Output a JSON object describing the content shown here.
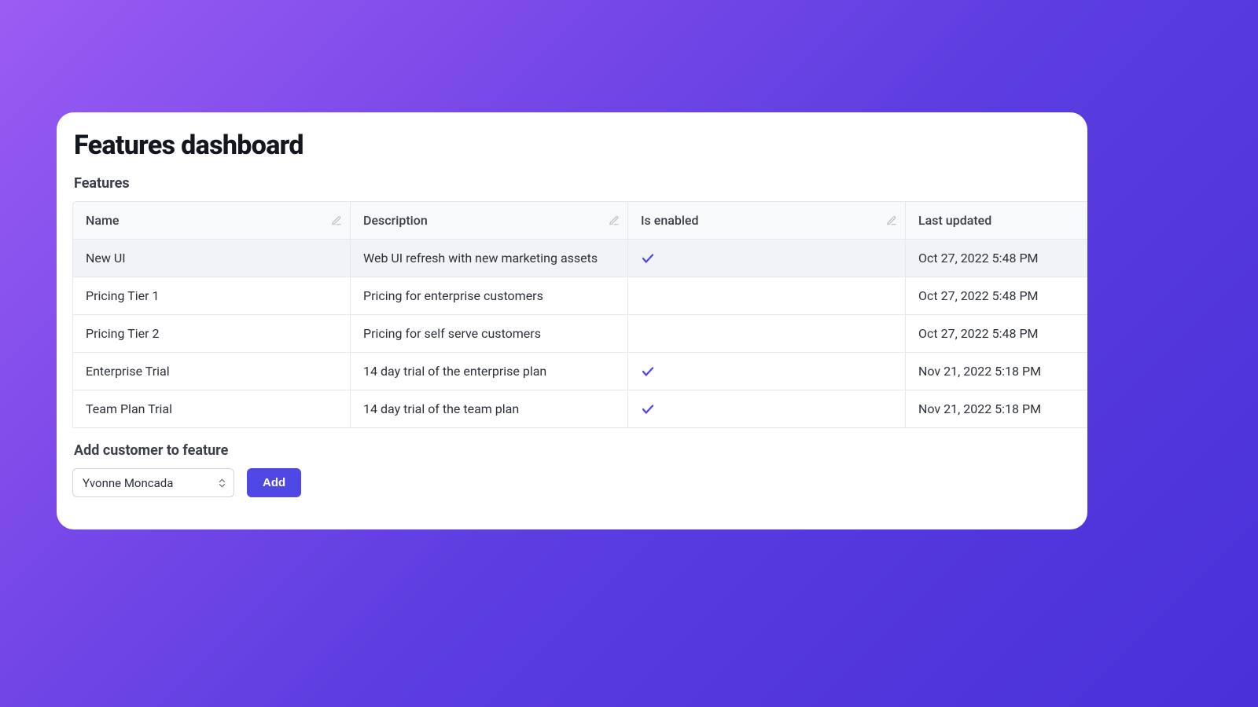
{
  "title": "Features dashboard",
  "section1_label": "Features",
  "columns": {
    "name": "Name",
    "description": "Description",
    "enabled": "Is enabled",
    "updated": "Last updated"
  },
  "rows": [
    {
      "name": "New UI",
      "description": "Web UI refresh with new marketing assets",
      "enabled": true,
      "updated": "Oct 27, 2022 5:48 PM"
    },
    {
      "name": "Pricing Tier 1",
      "description": "Pricing for enterprise customers",
      "enabled": false,
      "updated": "Oct 27, 2022 5:48 PM"
    },
    {
      "name": "Pricing Tier 2",
      "description": "Pricing for self serve customers",
      "enabled": false,
      "updated": "Oct 27, 2022 5:48 PM"
    },
    {
      "name": "Enterprise Trial",
      "description": "14 day trial of the enterprise plan",
      "enabled": true,
      "updated": "Nov 21, 2022 5:18 PM"
    },
    {
      "name": "Team Plan Trial",
      "description": "14 day trial of the team plan",
      "enabled": true,
      "updated": "Nov 21, 2022 5:18 PM"
    }
  ],
  "section2_label": "Add customer to feature",
  "customer_select": {
    "value": "Yvonne Moncada"
  },
  "add_button": "Add"
}
